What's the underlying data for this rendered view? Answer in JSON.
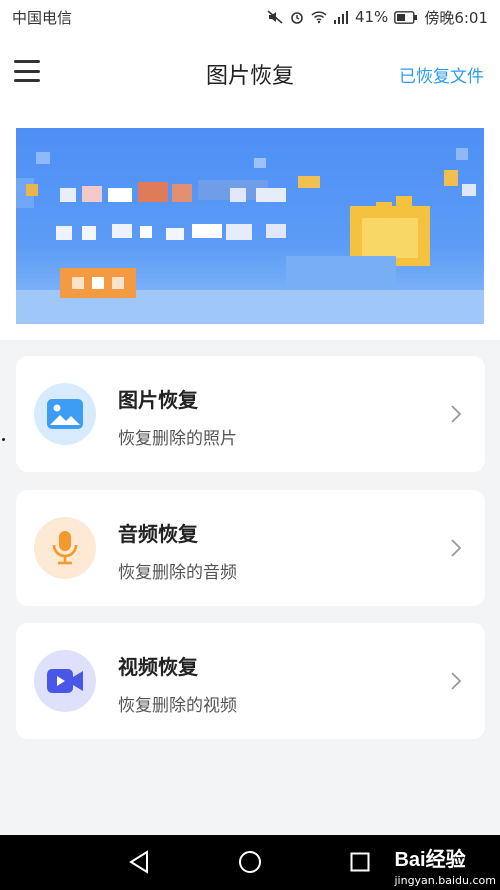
{
  "status_bar": {
    "carrier": "中国电信",
    "battery": "41%",
    "time": "傍晚6:01"
  },
  "header": {
    "title": "图片恢复",
    "recovered_link": "已恢复文件"
  },
  "cards": [
    {
      "title": "图片恢复",
      "subtitle": "恢复删除的照片",
      "icon": "image-icon",
      "color": "#3d9cf3",
      "bg": "#d8ebfd"
    },
    {
      "title": "音频恢复",
      "subtitle": "恢复删除的音频",
      "icon": "microphone-icon",
      "color": "#f39a2e",
      "bg": "#fde9d4"
    },
    {
      "title": "视频恢复",
      "subtitle": "恢复删除的视频",
      "icon": "video-camera-icon",
      "color": "#4a56e8",
      "bg": "#dfe1fb"
    }
  ],
  "watermark": {
    "brand": "Bai经验",
    "site": "jingyan.baidu.com"
  }
}
